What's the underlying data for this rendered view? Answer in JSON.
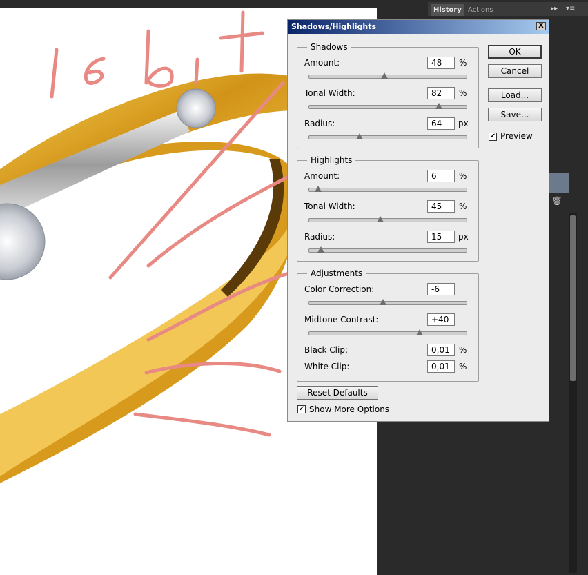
{
  "panel": {
    "tabs": [
      {
        "label": "History",
        "active": true
      },
      {
        "label": "Actions",
        "active": false
      }
    ]
  },
  "dialog": {
    "title": "Shadows/Highlights",
    "close_glyph": "X",
    "buttons": {
      "ok": "OK",
      "cancel": "Cancel",
      "load": "Load...",
      "save": "Save...",
      "reset_defaults": "Reset Defaults"
    },
    "preview": {
      "label": "Preview",
      "checked": true
    },
    "show_more_options": {
      "label": "Show More Options",
      "checked": true
    },
    "shadows": {
      "title": "Shadows",
      "amount": {
        "label": "Amount:",
        "value": "48",
        "unit": "%",
        "slider": 0.48
      },
      "tonal_width": {
        "label": "Tonal Width:",
        "value": "82",
        "unit": "%",
        "slider": 0.82
      },
      "radius": {
        "label": "Radius:",
        "value": "64",
        "unit": "px",
        "slider": 0.32
      }
    },
    "highlights": {
      "title": "Highlights",
      "amount": {
        "label": "Amount:",
        "value": "6",
        "unit": "%",
        "slider": 0.06
      },
      "tonal_width": {
        "label": "Tonal Width:",
        "value": "45",
        "unit": "%",
        "slider": 0.45
      },
      "radius": {
        "label": "Radius:",
        "value": "15",
        "unit": "px",
        "slider": 0.08
      }
    },
    "adjustments": {
      "title": "Adjustments",
      "color_correction": {
        "label": "Color Correction:",
        "value": "-6",
        "slider": 0.47
      },
      "midtone_contrast": {
        "label": "Midtone Contrast:",
        "value": "+40",
        "slider": 0.7
      },
      "black_clip": {
        "label": "Black Clip:",
        "value": "0,01",
        "unit": "%"
      },
      "white_clip": {
        "label": "White Clip:",
        "value": "0,01",
        "unit": "%"
      }
    }
  },
  "canvas": {
    "handwriting": "16bit",
    "colors": {
      "gold": "#e0a823",
      "annotation": "#e88a83",
      "dark_panel": "#2a2a2a"
    }
  }
}
